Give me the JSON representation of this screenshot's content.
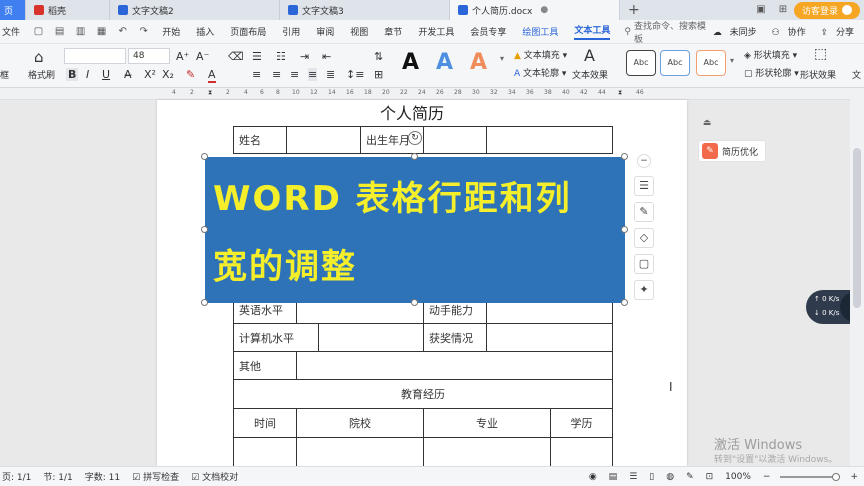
{
  "tabs": [
    {
      "label": "页",
      "color": "#3f7ff0"
    },
    {
      "label": "稻壳",
      "color": "#d9342b"
    },
    {
      "label": "文字文稿2",
      "color": "#2a66d8"
    },
    {
      "label": "文字文稿3",
      "color": "#2a66d8"
    },
    {
      "label": "个人简历.docx",
      "color": "#2a66d8",
      "active": true
    }
  ],
  "login_label": "访客登录",
  "menu": {
    "file": "文件",
    "items": [
      "开始",
      "插入",
      "页面布局",
      "引用",
      "审阅",
      "视图",
      "章节",
      "开发工具",
      "会员专享"
    ],
    "ctx_items": [
      "绘图工具",
      "文本工具"
    ],
    "search_placeholder": "查找命令、搜索模板",
    "right": [
      "未同步",
      "协作",
      "分享"
    ]
  },
  "ribbon": {
    "format_painter": "格式刷",
    "frame_label": "框",
    "font_size": "48",
    "bold": "B",
    "italic": "I",
    "underline": "U",
    "art_letter": "A",
    "text_fill": "文本填充",
    "text_outline": "文本轮廓",
    "text_effect": "文本效果",
    "abc": "Abc",
    "shape_fill": "形状填充",
    "shape_outline": "形状轮廓",
    "shape_effect": "形状效果",
    "more": "文"
  },
  "ruler": {
    "labels": [
      "4",
      "2",
      "2",
      "4",
      "6",
      "8",
      "10",
      "12",
      "14",
      "16",
      "18",
      "20",
      "22",
      "24",
      "26",
      "28",
      "30",
      "32",
      "34",
      "36",
      "38",
      "40",
      "42",
      "44",
      "46"
    ]
  },
  "document": {
    "title": "个人简历",
    "cells": {
      "name": "姓名",
      "birth": "出生年月",
      "english": "英语水平",
      "hands_on": "动手能力",
      "computer": "计算机水平",
      "awards": "获奖情况",
      "other": "其他",
      "education": "教育经历",
      "time": "时间",
      "school": "院校",
      "major": "专业",
      "degree": "学历"
    }
  },
  "banner": {
    "line1": "WORD 表格行距和列",
    "line2": "宽的调整",
    "bg": "#2e73b8",
    "fg": "#f5ee2a"
  },
  "side_panel": {
    "resume_opt": "简历优化"
  },
  "speed": {
    "up": "0 K/s",
    "down": "0 K/s",
    "badge": "5"
  },
  "watermark": {
    "line1": "激活 Windows",
    "line2": "转到\"设置\"以激活 Windows。"
  },
  "status": {
    "page": "页: 1/1",
    "section": "节: 1/1",
    "words": "字数: 11",
    "spell": "拼写检查",
    "doc_check": "文档校对",
    "zoom": "100%"
  }
}
